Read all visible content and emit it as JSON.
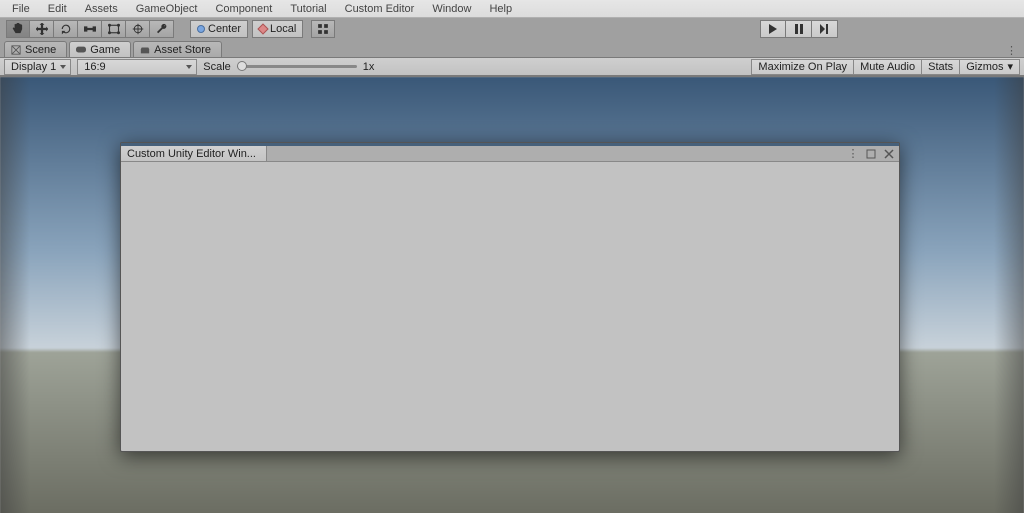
{
  "menubar": [
    "File",
    "Edit",
    "Assets",
    "GameObject",
    "Component",
    "Tutorial",
    "Custom Editor",
    "Window",
    "Help"
  ],
  "toolbar": {
    "pivot_label": "Center",
    "space_label": "Local"
  },
  "tabs": {
    "scene": "Scene",
    "game": "Game",
    "assetstore": "Asset Store"
  },
  "controlrow": {
    "display": "Display 1",
    "aspect": "16:9",
    "scale_label": "Scale",
    "scale_value": "1x",
    "maximize": "Maximize On Play",
    "mute": "Mute Audio",
    "stats": "Stats",
    "gizmos": "Gizmos"
  },
  "floating_window": {
    "title": "Custom Unity Editor Win..."
  }
}
